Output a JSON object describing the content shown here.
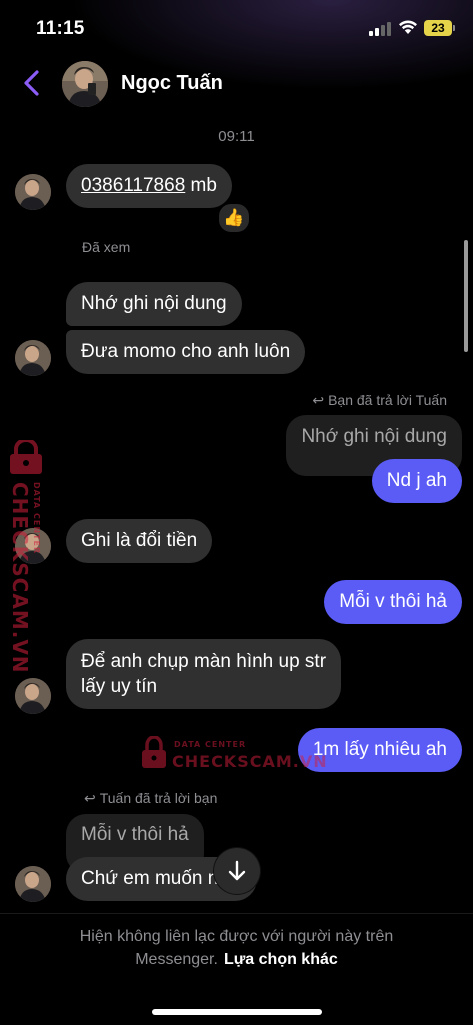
{
  "status_bar": {
    "time": "11:15",
    "battery": "23"
  },
  "header": {
    "contact_name": "Ngọc Tuấn"
  },
  "thread": {
    "timestamp": "09:11",
    "msg1": {
      "phone": "0386117868",
      "suffix": " mb",
      "reaction": "👍"
    },
    "seen": "Đã xem",
    "msg2": "Nhớ ghi nội dung",
    "msg3": "Đưa momo cho anh luôn",
    "reply_label_you": "Bạn đã trả lời Tuấn",
    "quoted_you": "Nhớ ghi nội dung",
    "msg4": "Nd j ah",
    "msg5": "Ghi là đổi tiền",
    "msg6": "Mỗi v thôi hả",
    "msg7_line1": "Để anh chụp màn hình up str",
    "msg7_line2": "lấy uy tín",
    "msg8": "1m lấy nhiêu ah",
    "reply_label_tuan": "Tuấn đã trả lời bạn",
    "quoted_tuan": "Mỗi v thôi hả",
    "msg9": "Chứ em muốn nữa"
  },
  "watermark": {
    "brand": "CHECKSCAM.VN",
    "sub": "DATA CENTER"
  },
  "footer": {
    "notice_line1": "Hiện không liên lạc được với người này trên",
    "notice_line2": "Messenger.",
    "other_options": "Lựa chọn khác"
  },
  "colors": {
    "outgoing_bubble": "#5b5cf6",
    "incoming_bubble": "#303030",
    "accent_back": "#8b5cf6"
  }
}
